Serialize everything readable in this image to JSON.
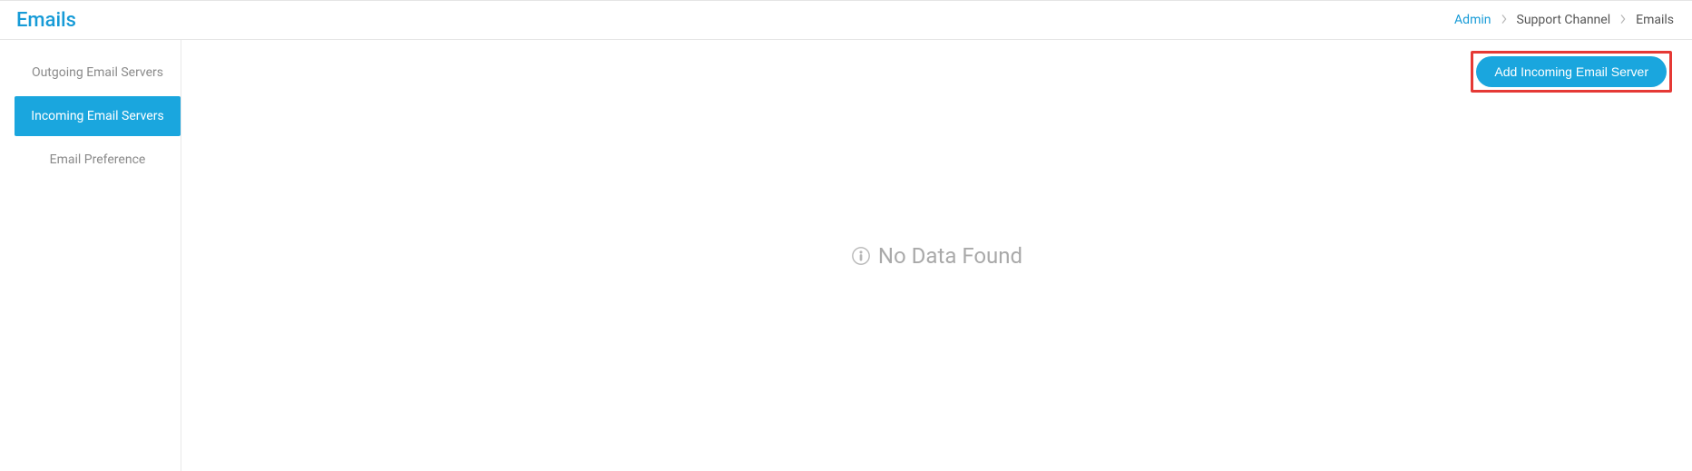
{
  "header": {
    "title": "Emails"
  },
  "breadcrumb": {
    "items": [
      {
        "label": "Admin",
        "link": true
      },
      {
        "label": "Support Channel",
        "link": false
      },
      {
        "label": "Emails",
        "link": false
      }
    ]
  },
  "sidebar": {
    "items": [
      {
        "label": "Outgoing Email Servers",
        "active": false
      },
      {
        "label": "Incoming Email Servers",
        "active": true
      },
      {
        "label": "Email Preference",
        "active": false
      }
    ]
  },
  "actions": {
    "add_incoming_label": "Add Incoming Email Server"
  },
  "main": {
    "empty_message": "No Data Found"
  }
}
